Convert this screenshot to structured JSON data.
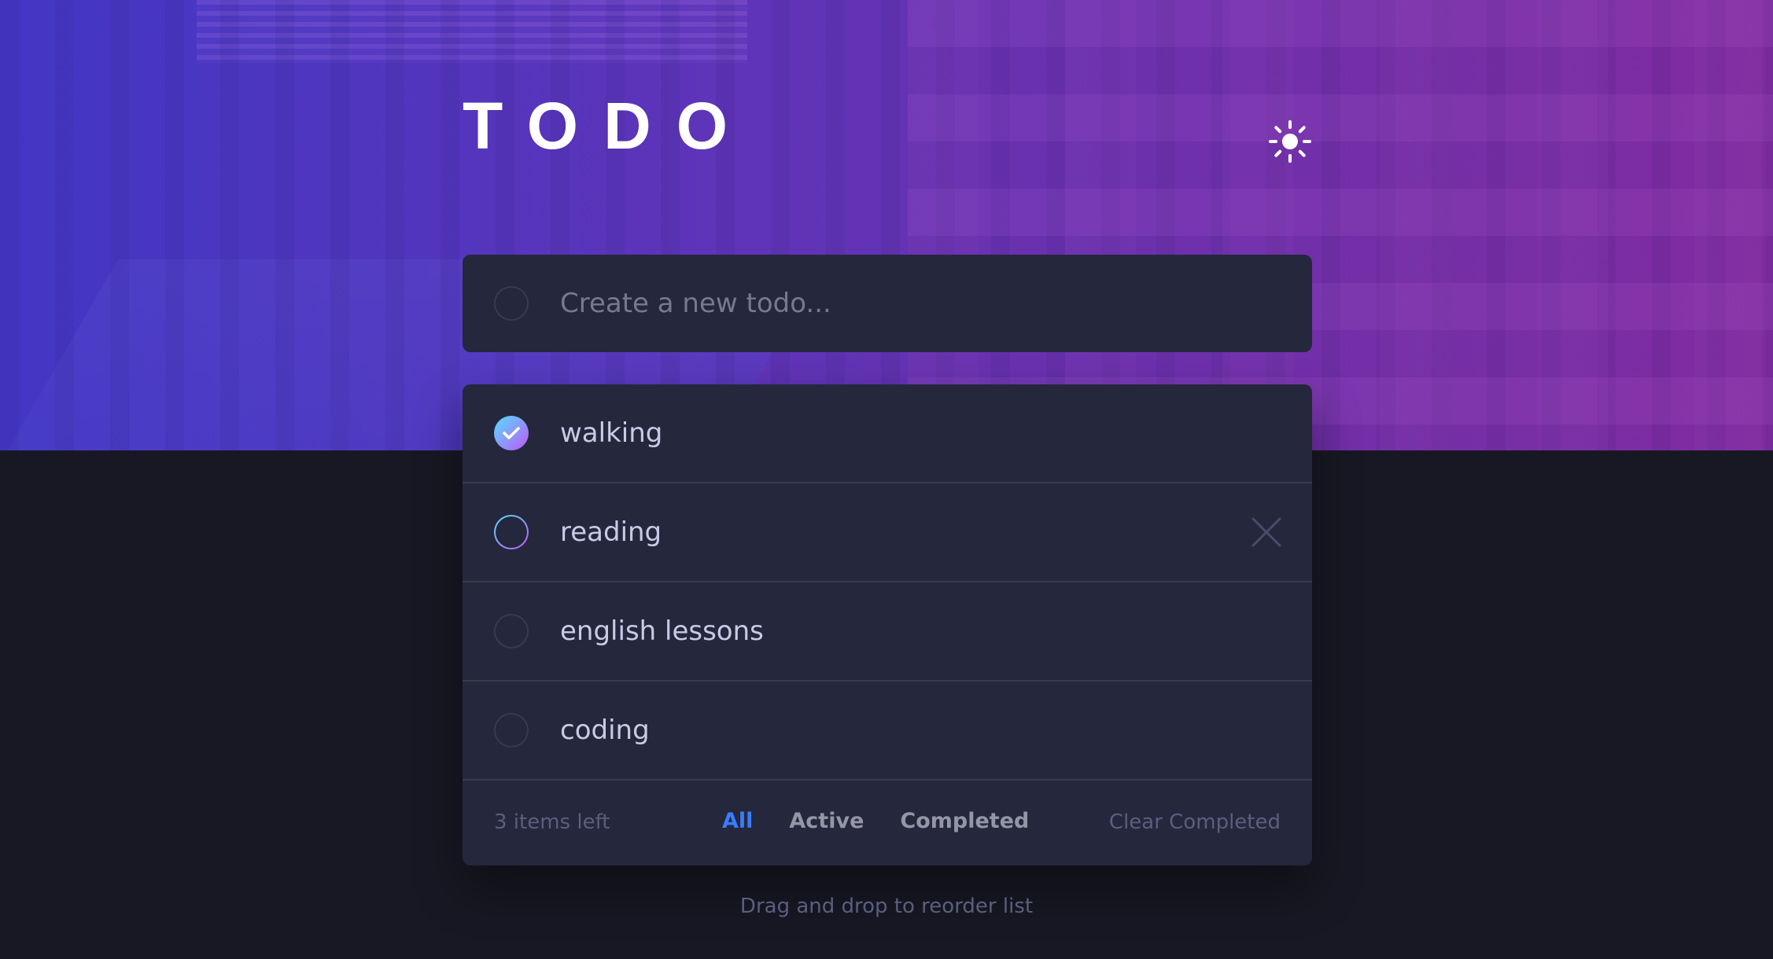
{
  "header": {
    "title": "TODO",
    "theme_toggle_icon": "sun-icon"
  },
  "new_todo": {
    "placeholder": "Create a new todo..."
  },
  "todos": [
    {
      "text": "walking",
      "completed": true
    },
    {
      "text": "reading",
      "completed": false
    },
    {
      "text": "english lessons",
      "completed": false
    },
    {
      "text": "coding",
      "completed": false
    }
  ],
  "footer": {
    "items_left": "3 items left",
    "filters": [
      "All",
      "Active",
      "Completed"
    ],
    "active_filter": "All",
    "clear_label": "Clear Completed"
  },
  "hint": "Drag and drop to reorder list",
  "colors": {
    "accent": "#3a7cfd",
    "check_gradient_start": "#55ddff",
    "check_gradient_end": "#c058f3",
    "panel": "#25273c",
    "background": "#181824"
  }
}
